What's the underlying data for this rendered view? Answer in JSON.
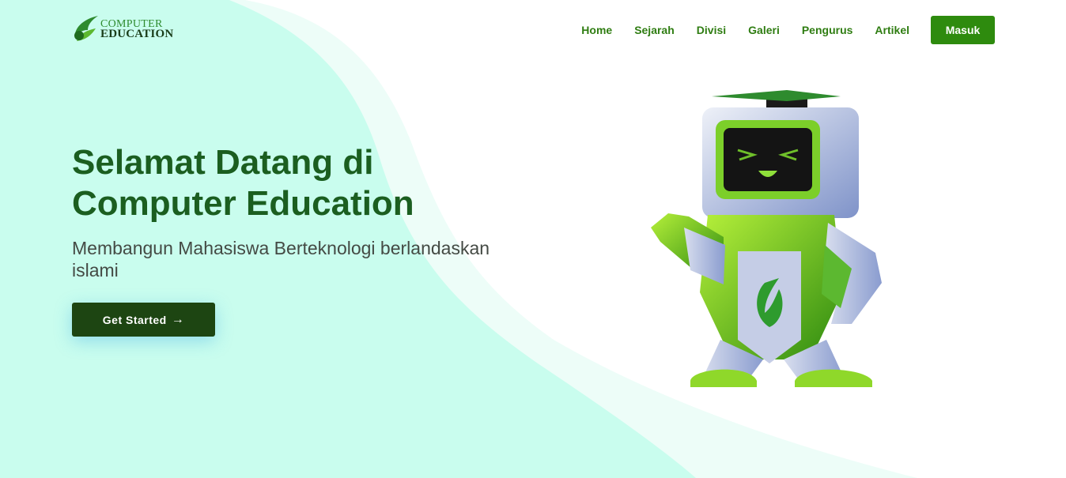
{
  "brand": {
    "logo_line1": "COMPUTER",
    "logo_line2": "EDUCATION"
  },
  "nav": {
    "links": [
      "Home",
      "Sejarah",
      "Divisi",
      "Galeri",
      "Pengurus",
      "Artikel"
    ],
    "login_label": "Masuk"
  },
  "hero": {
    "title": "Selamat Datang di Computer Education",
    "subtitle": "Membangun Mahasiswa Berteknologi berlandaskan islami",
    "cta_label": "Get Started",
    "cta_icon": "arrow-right-icon"
  },
  "colors": {
    "brand_green": "#2e8b0e",
    "title_green": "#1b5e20",
    "cta_dark": "#1d4512",
    "wave_mint": "#c9fdee"
  }
}
